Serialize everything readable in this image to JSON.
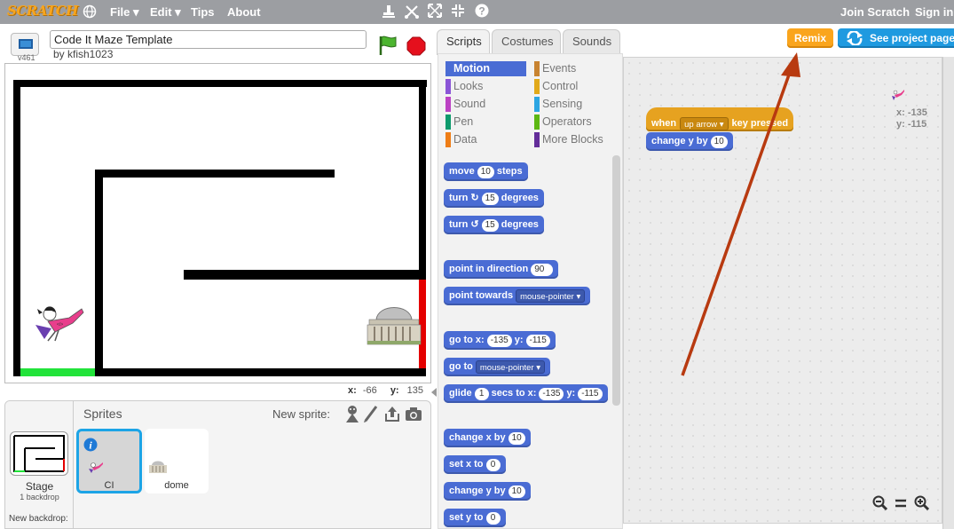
{
  "topbar": {
    "logo": "SCRATCH",
    "menus": [
      "File ▾",
      "Edit ▾",
      "Tips",
      "About"
    ],
    "join": "Join Scratch",
    "signin": "Sign in"
  },
  "project": {
    "title": "Code It Maze Template",
    "author": "by kfish1023",
    "version": "v461"
  },
  "stage": {
    "x_label": "x:",
    "x_value": "-66",
    "y_label": "y:",
    "y_value": "135"
  },
  "sprites_pane": {
    "title": "Sprites",
    "new_sprite_label": "New sprite:",
    "stage_label": "Stage",
    "backdrop_count": "1 backdrop",
    "new_backdrop_label": "New backdrop:",
    "sprites": [
      {
        "name": "CI",
        "selected": true
      },
      {
        "name": "dome",
        "selected": false
      }
    ]
  },
  "tabs": [
    "Scripts",
    "Costumes",
    "Sounds"
  ],
  "categories": {
    "left": [
      {
        "label": "Motion",
        "color": "#4a6cd4",
        "active": true
      },
      {
        "label": "Looks",
        "color": "#8a55d7"
      },
      {
        "label": "Sound",
        "color": "#bb42c3"
      },
      {
        "label": "Pen",
        "color": "#0e9a6c"
      },
      {
        "label": "Data",
        "color": "#ee7d16"
      }
    ],
    "right": [
      {
        "label": "Events",
        "color": "#c88330"
      },
      {
        "label": "Control",
        "color": "#e1a91a"
      },
      {
        "label": "Sensing",
        "color": "#2ca5e2"
      },
      {
        "label": "Operators",
        "color": "#5cb712"
      },
      {
        "label": "More Blocks",
        "color": "#632d99"
      }
    ]
  },
  "blocks": {
    "move": {
      "a": "move",
      "n": "10",
      "b": "steps"
    },
    "turn_cw": {
      "a": "turn",
      "n": "15",
      "b": "degrees"
    },
    "turn_ccw": {
      "a": "turn",
      "n": "15",
      "b": "degrees"
    },
    "point_dir": {
      "a": "point in direction",
      "v": "90"
    },
    "point_towards": {
      "a": "point towards",
      "v": "mouse-pointer"
    },
    "goto_xy": {
      "a": "go to x:",
      "x": "-135",
      "b": "y:",
      "y": "-115"
    },
    "goto": {
      "a": "go to",
      "v": "mouse-pointer"
    },
    "glide": {
      "a": "glide",
      "n": "1",
      "b": "secs to x:",
      "x": "-135",
      "c": "y:",
      "y": "-115"
    },
    "change_x": {
      "a": "change x by",
      "n": "10"
    },
    "set_x": {
      "a": "set x to",
      "n": "0"
    },
    "change_y": {
      "a": "change y by",
      "n": "10"
    },
    "set_y": {
      "a": "set y to",
      "n": "0"
    }
  },
  "script": {
    "hat_when": "when",
    "hat_key": "up arrow",
    "hat_rest": "key pressed",
    "cmd_label": "change y by",
    "cmd_value": "10",
    "sprite_x": "x: -135",
    "sprite_y": "y: -115"
  },
  "buttons": {
    "remix": "Remix",
    "see_project": "See project page"
  },
  "colors": {
    "accent_orange": "#faa51d",
    "accent_blue": "#1f9ae0",
    "motion_blue": "#4a6cd4",
    "events_orange": "#e6a220",
    "annotation_arrow": "#b83a10"
  }
}
